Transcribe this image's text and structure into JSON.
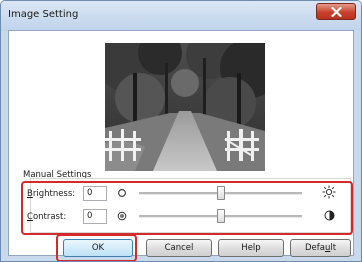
{
  "window": {
    "title": "Image Setting"
  },
  "manual_settings": {
    "group_label": "Manual Settings",
    "brightness": {
      "label_pre": "",
      "label_mnemonic": "B",
      "label_post": "rightness:",
      "value": "0",
      "level_percent": 50
    },
    "contrast": {
      "label_pre": "",
      "label_mnemonic": "C",
      "label_post": "ontrast:",
      "value": "0",
      "level_percent": 50
    }
  },
  "buttons": {
    "ok": "OK",
    "cancel": "Cancel",
    "help": "Help",
    "default_pre": "Defa",
    "default_mnemonic": "u",
    "default_post": "lt"
  },
  "colors": {
    "highlight": "#d42a2a",
    "title_bar": "#bfd3ea",
    "close_button": "#c7422d"
  },
  "icons": {
    "close": "close-x-icon",
    "brightness_low": "sun-outline-icon",
    "brightness_high": "sun-bright-icon",
    "contrast_low": "contrast-low-icon",
    "contrast_high": "contrast-high-icon"
  }
}
